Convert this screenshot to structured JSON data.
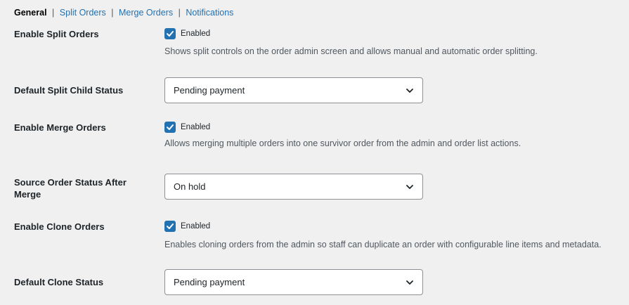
{
  "subnav": {
    "current": "General",
    "links": [
      "Split Orders",
      "Merge Orders",
      "Notifications"
    ]
  },
  "rows": {
    "split": {
      "label": "Enable Split Orders",
      "checkbox_label": "Enabled",
      "checked": true,
      "description": "Shows split controls on the order admin screen and allows manual and automatic order splitting."
    },
    "split_status": {
      "label": "Default Split Child Status",
      "value": "Pending payment"
    },
    "merge": {
      "label": "Enable Merge Orders",
      "checkbox_label": "Enabled",
      "checked": true,
      "description": "Allows merging multiple orders into one survivor order from the admin and order list actions."
    },
    "merge_status": {
      "label": "Source Order Status After Merge",
      "value": "On hold"
    },
    "clone": {
      "label": "Enable Clone Orders",
      "checkbox_label": "Enabled",
      "checked": true,
      "description": "Enables cloning orders from the admin so staff can duplicate an order with configurable line items and metadata."
    },
    "clone_status": {
      "label": "Default Clone Status",
      "value": "Pending payment"
    }
  },
  "colors": {
    "accent": "#2271b1",
    "background": "#f0f0f1",
    "text": "#1d2327",
    "muted": "#50575e"
  },
  "icons": {
    "checkbox": "checkmark-icon",
    "select": "chevron-down-icon"
  }
}
